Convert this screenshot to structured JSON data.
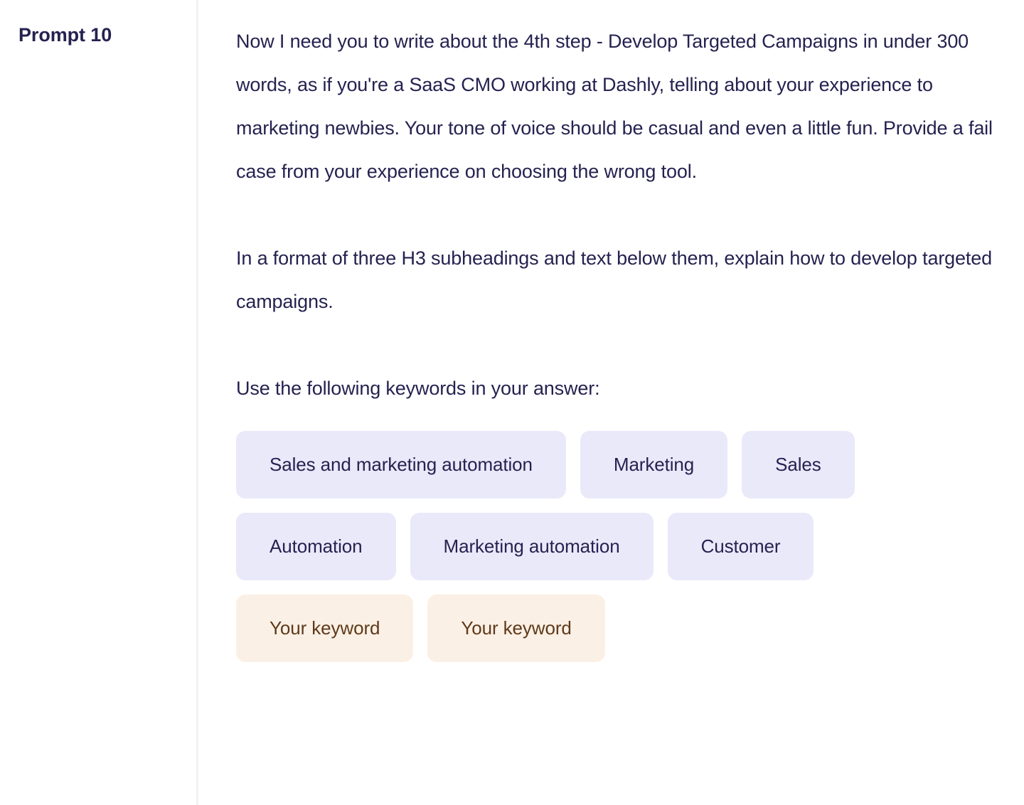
{
  "prompt": {
    "label": "Prompt 10",
    "paragraphs": [
      "Now I need you to write about the 4th step - Develop Targeted Campaigns in under 300 words, as if you're a SaaS CMO working at Dashly, telling about your experience to marketing newbies. Your tone of voice should be casual and even a little fun. Provide a fail case from your experience on choosing the wrong tool.",
      "In a format of three H3 subheadings and text below them, explain how to develop targeted campaigns.",
      "Use the following keywords in your answer:"
    ],
    "keywords": [
      {
        "label": "Sales and marketing automation",
        "variant": "lavender"
      },
      {
        "label": "Marketing",
        "variant": "lavender"
      },
      {
        "label": "Sales",
        "variant": "lavender"
      },
      {
        "label": "Automation",
        "variant": "lavender"
      },
      {
        "label": "Marketing automation",
        "variant": "lavender"
      },
      {
        "label": "Customer",
        "variant": "lavender"
      },
      {
        "label": "Your keyword",
        "variant": "peach"
      },
      {
        "label": "Your keyword",
        "variant": "peach"
      }
    ]
  },
  "colors": {
    "text_navy": "#252250",
    "chip_lavender_bg": "#EAE9FA",
    "chip_peach_bg": "#FBF0E5",
    "chip_peach_text": "#5E3A1B",
    "divider": "#F2F2F5",
    "page_bg": "#FFFFFF"
  }
}
